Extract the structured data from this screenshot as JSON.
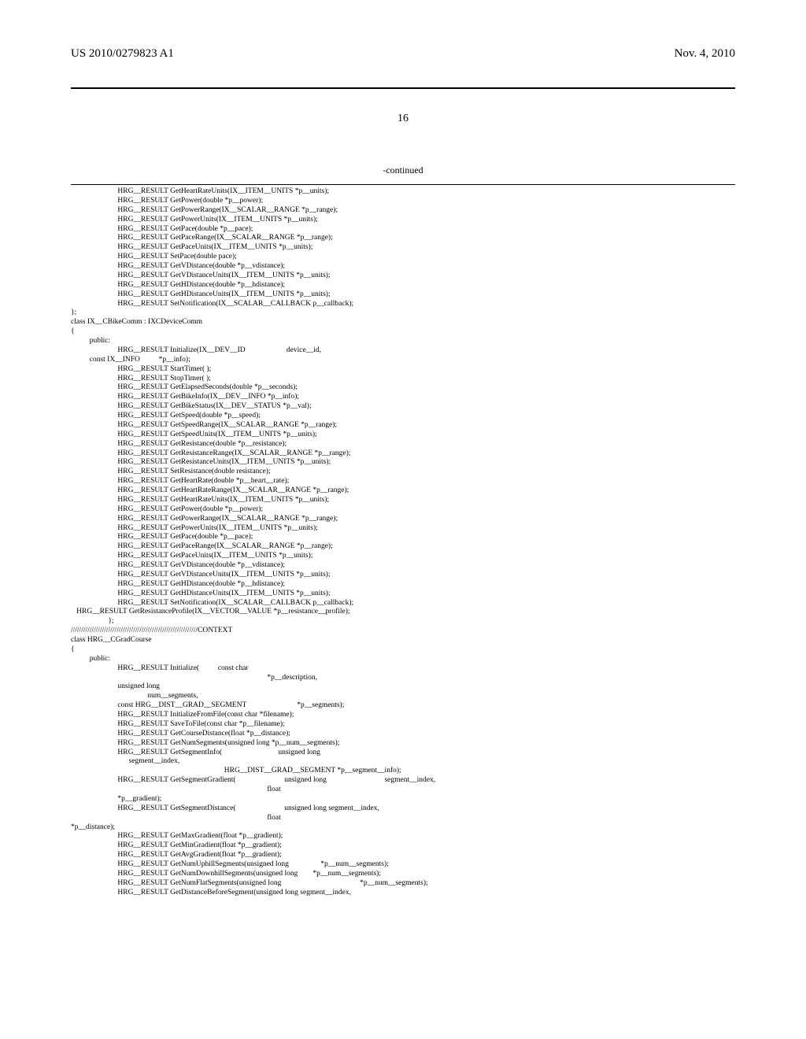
{
  "header": {
    "pub_number": "US 2010/0279823 A1",
    "date": "Nov. 4, 2010"
  },
  "page_number": "16",
  "continued_label": "-continued",
  "code_block": "                         HRG__RESULT GetHeartRateUnits(IX__ITEM__UNITS *p__units);\n                         HRG__RESULT GetPower(double *p__power);\n                         HRG__RESULT GetPowerRange(IX__SCALAR__RANGE *p__range);\n                         HRG__RESULT GetPowerUnits(IX__ITEM__UNITS *p__units);\n                         HRG__RESULT GetPace(double *p__pace);\n                         HRG__RESULT GetPaceRange(IX__SCALAR__RANGE *p__range);\n                         HRG__RESULT GetPaceUnits(IX__ITEM__UNITS *p__units);\n                         HRG__RESULT SetPace(double pace);\n                         HRG__RESULT GetVDistance(double *p__vdistance);\n                         HRG__RESULT GetVDistanceUnits(IX__ITEM__UNITS *p__units);\n                         HRG__RESULT GetHDistance(double *p__hdistance);\n                         HRG__RESULT GetHDistanceUnits(IX__ITEM__UNITS *p__units);\n                         HRG__RESULT SetNotification(IX__SCALAR__CALLBACK p__callback);\n};\nclass IX__CBikeComm : IXCDeviceComm\n{\n          public:\n                         HRG__RESULT Initialize(IX__DEV__ID                      device__id,\n          const IX__INFO          *p__info);\n                         HRG__RESULT StartTimer( );\n                         HRG__RESULT StopTimer( );\n                         HRG__RESULT GetElapsedSeconds(double *p__seconds);\n                         HRG__RESULT GetBikeInfo(IX__DEV__INFO *p__info);\n                         HRG__RESULT GetBikeStatus(IX__DEV__STATUS *p__val);\n                         HRG__RESULT GetSpeed(double *p__speed);\n                         HRG__RESULT GetSpeedRange(IX__SCALAR__RANGE *p__range);\n                         HRG__RESULT GetSpeedUnits(IX__ITEM__UNITS *p__units);\n                         HRG__RESULT GetResistance(double *p__resistance);\n                         HRG__RESULT GetResistanceRange(IX__SCALAR__RANGE *p__range);\n                         HRG__RESULT GetResistanceUnits(IX__ITEM__UNITS *p__units);\n                         HRG__RESULT SetResistance(double resistance);\n                         HRG__RESULT GetHeartRate(double *p__heart__rate);\n                         HRG__RESULT GetHeartRateRange(IX__SCALAR__RANGE *p__range);\n                         HRG__RESULT GetHeartRateUnits(IX__ITEM__UNITS *p__units);\n                         HRG__RESULT GetPower(double *p__power);\n                         HRG__RESULT GetPowerRange(IX__SCALAR__RANGE *p__range);\n                         HRG__RESULT GetPowerUnits(IX__ITEM__UNITS *p__units);\n                         HRG__RESULT GetPace(double *p__pace);\n                         HRG__RESULT GetPaceRange(IX__SCALAR__RANGE *p__range);\n                         HRG__RESULT GetPaceUnits(IX__ITEM__UNITS *p__units);\n                         HRG__RESULT GetVDistance(double *p__vdistance);\n                         HRG__RESULT GetVDistanceUnits(IX__ITEM__UNITS *p__units);\n                         HRG__RESULT GetHDistance(double *p__hdistance);\n                         HRG__RESULT GetHDistanceUnits(IX__ITEM__UNITS *p__units);\n                         HRG__RESULT SetNotification(IX__SCALAR__CALLBACK p__callback);\n   HRG__RESULT GetResistanceProfile(IX__VECTOR__VALUE *p__resistance__profile);\n                    };\n/////////////////////////////////////////////////////////////CONTEXT\nclass HRG__CGradCourse\n{\n          public:\n                         HRG__RESULT Initialize(          const char\n                                                                                                         *p__description,\n                         unsigned long\n                                         num__segments,\n                         const HRG__DIST__GRAD__SEGMENT                           *p__segments);\n                         HRG__RESULT InitializeFromFile(const char *filename);\n                         HRG__RESULT SaveToFile(const char *p__filename);\n                         HRG__RESULT GetCourseDistance(float *p__distance);\n                         HRG__RESULT GetNumSegments(unsigned long *p__num__segments);\n                         HRG__RESULT GetSegmentInfo(                              unsigned long\n                               segment__index,\n                                                                                  HRG__DIST__GRAD__SEGMENT *p__segment__info);\n                         HRG__RESULT GetSegmentGradient(                          unsigned long                               segment__index,\n                                                                                                         float\n                         *p__gradient);\n                         HRG__RESULT GetSegmentDistance(                          unsigned long segment__index,\n                                                                                                         float\n*p__distance);\n                         HRG__RESULT GetMaxGradient(float *p__gradient);\n                         HRG__RESULT GetMinGradient(float *p__gradient);\n                         HRG__RESULT GetAvgGradient(float *p__gradient);\n                         HRG__RESULT GetNumUphillSegments(unsigned long                 *p__num__segments);\n                         HRG__RESULT GetNumDownhillSegments(unsigned long        *p__num__segments);\n                         HRG__RESULT GetNumFlatSegments(unsigned long                                          *p__num__segments);\n                         HRG__RESULT GetDistanceBeforeSegment(unsigned long segment__index,"
}
